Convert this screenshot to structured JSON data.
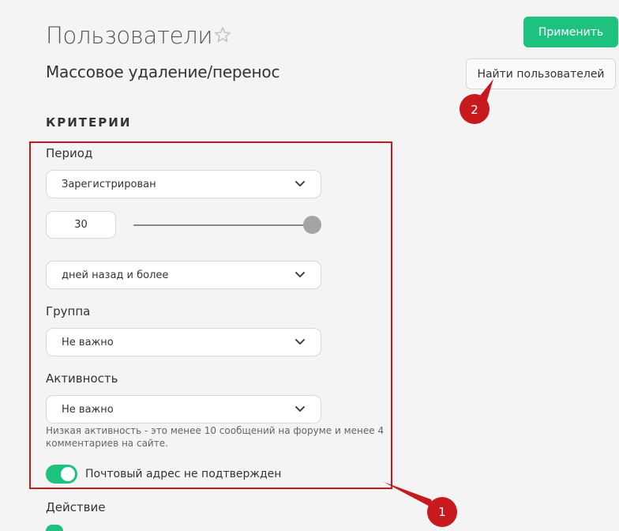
{
  "page": {
    "title": "Пользователи",
    "subtitle": "Массовое удаление/перенос",
    "apply_label": "Применить",
    "find_users_label": "Найти пользователей"
  },
  "criteria": {
    "section_title": "КРИТЕРИИ",
    "period_label": "Период",
    "period_select": "Зарегистрирован",
    "days_value": "30",
    "slider_level": 1.0,
    "days_select": "дней назад и более",
    "group_label": "Группа",
    "group_select": "Не важно",
    "activity_label": "Активность",
    "activity_select": "Не важно",
    "activity_hint": "Низкая активность - это менее 10 сообщений на форуме и менее 4 комментариев на сайте.",
    "email_toggle_on": true,
    "email_toggle_label": "Почтовый адрес не подтвержден"
  },
  "action": {
    "label": "Действие"
  },
  "annotations": {
    "badge_1": "1",
    "badge_2": "2"
  },
  "colors": {
    "accent": "#1ec27f",
    "annotation": "#c8191f",
    "background": "#f4f4f4"
  },
  "icons": {
    "favorite": "star-icon",
    "dropdown": "chevron-down-icon"
  }
}
